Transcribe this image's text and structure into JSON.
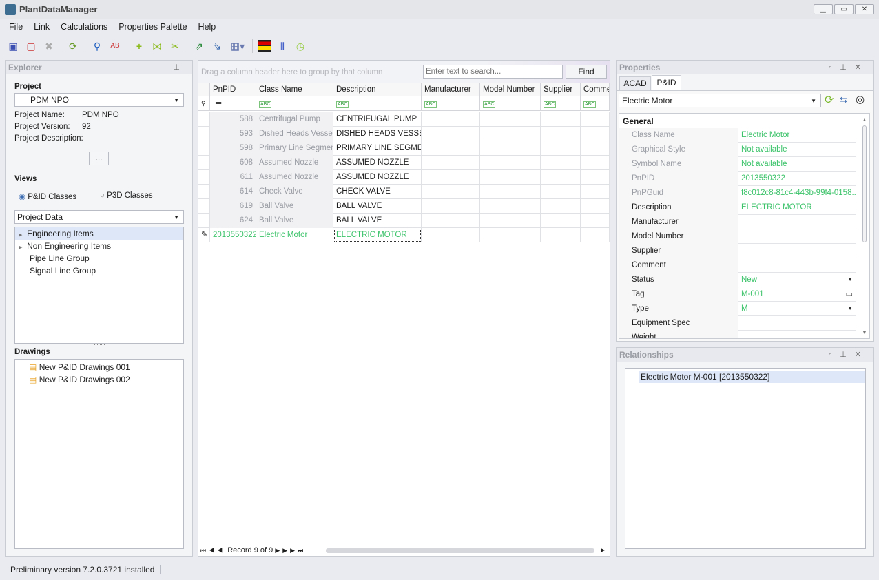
{
  "app": {
    "title": "PlantDataManager"
  },
  "menu": [
    "File",
    "Link",
    "Calculations",
    "Properties Palette",
    "Help"
  ],
  "explorer": {
    "title": "Explorer",
    "project_label": "Project",
    "project_value": "PDM NPO",
    "info": [
      {
        "k": "Project Name:",
        "v": "PDM NPO"
      },
      {
        "k": "Project Version:",
        "v": "92"
      },
      {
        "k": "Project Description:",
        "v": ""
      }
    ],
    "more_button": "...",
    "views_label": "Views",
    "radio_pid": "P&ID Classes",
    "radio_p3d": "P3D Classes",
    "selected_view": "P&ID Classes",
    "data_select": "Project Data",
    "tree": [
      "Engineering Items",
      "Non Engineering Items",
      "Pipe Line Group",
      "Signal Line Group"
    ],
    "drawings_label": "Drawings",
    "drawings": [
      "New P&ID Drawings 001",
      "New P&ID Drawings 002"
    ]
  },
  "grid": {
    "group_hint": "Drag a column header here to group by that column",
    "search_placeholder": "Enter text to search...",
    "find_button": "Find",
    "columns": [
      "PnPID",
      "Class Name",
      "Description",
      "Manufacturer",
      "Model Number",
      "Supplier",
      "Comment"
    ],
    "rows": [
      [
        "588",
        "Centrifugal Pump",
        "CENTRIFUGAL PUMP"
      ],
      [
        "593",
        "Dished Heads Vessel",
        "DISHED HEADS VESSEL"
      ],
      [
        "598",
        "Primary Line Segment",
        "PRIMARY LINE SEGMENT"
      ],
      [
        "608",
        "Assumed Nozzle",
        "ASSUMED NOZZLE"
      ],
      [
        "611",
        "Assumed Nozzle",
        "ASSUMED NOZZLE"
      ],
      [
        "614",
        "Check Valve",
        "CHECK VALVE"
      ],
      [
        "619",
        "Ball Valve",
        "BALL VALVE"
      ],
      [
        "624",
        "Ball Valve",
        "BALL VALVE"
      ],
      [
        "2013550322",
        "Electric Motor",
        "ELECTRIC MOTOR"
      ]
    ],
    "record_text": "Record 9 of 9"
  },
  "properties": {
    "title": "Properties",
    "tabs": [
      "ACAD",
      "P&ID"
    ],
    "active_tab": "P&ID",
    "class_select": "Electric Motor",
    "section": "General",
    "rows": [
      {
        "k": "Class Name",
        "v": "Electric Motor",
        "ro": true
      },
      {
        "k": "Graphical Style",
        "v": "Not available",
        "ro": true
      },
      {
        "k": "Symbol Name",
        "v": "Not available",
        "ro": true
      },
      {
        "k": "PnPID",
        "v": "2013550322",
        "ro": true
      },
      {
        "k": "PnPGuid",
        "v": "f8c012c8-81c4-443b-99f4-0158...",
        "ro": true
      },
      {
        "k": "Description",
        "v": "ELECTRIC MOTOR"
      },
      {
        "k": "Manufacturer",
        "v": ""
      },
      {
        "k": "Model Number",
        "v": ""
      },
      {
        "k": "Supplier",
        "v": ""
      },
      {
        "k": "Comment",
        "v": ""
      },
      {
        "k": "Status",
        "v": "New",
        "dd": true
      },
      {
        "k": "Tag",
        "v": "M-001",
        "ed": true
      },
      {
        "k": "Type",
        "v": "M",
        "dd": true
      },
      {
        "k": "Equipment Spec",
        "v": ""
      },
      {
        "k": "Weight",
        "v": ""
      }
    ]
  },
  "relationships": {
    "title": "Relationships",
    "items": [
      "Electric Motor M-001 [2013550322]"
    ]
  },
  "status": {
    "text": "Preliminary version 7.2.0.3721 installed"
  },
  "colors": {
    "accent_green": "#3cc36a",
    "selection": "#dde7f7"
  }
}
